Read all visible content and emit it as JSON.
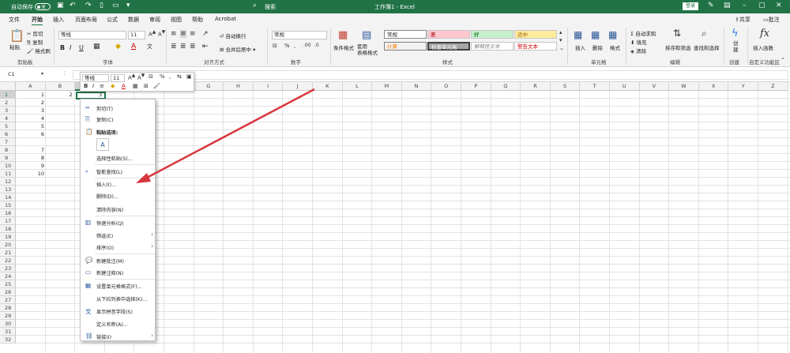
{
  "titlebar": {
    "autosave_label": "自动保存",
    "toggle_state": "关",
    "search_label": "搜索",
    "doc_title": "工作簿1 - Excel",
    "login_label": "登录"
  },
  "menu": [
    "文件",
    "开始",
    "插入",
    "页面布局",
    "公式",
    "数据",
    "审阅",
    "视图",
    "帮助",
    "Acrobat"
  ],
  "share_label": "共享",
  "comment_label": "批注",
  "ribbon": {
    "clipboard": {
      "paste": "粘贴",
      "cut": "剪切",
      "copy": "复制",
      "format_painter": "格式刷",
      "group": "剪贴板"
    },
    "font": {
      "name": "等线",
      "size": "11",
      "bold": "B",
      "italic": "I",
      "underline": "U",
      "group": "字体"
    },
    "alignment": {
      "wrap": "自动换行",
      "merge": "合并后居中",
      "group": "对齐方式"
    },
    "number": {
      "format": "常规",
      "group": "数字"
    },
    "styles": {
      "conditional": "条件格式",
      "table_format": "套用\n表格格式",
      "cells": [
        "常规",
        "差",
        "好",
        "适中",
        "计算",
        "检查单元格",
        "解释性文本",
        "警告文本"
      ],
      "group": "样式"
    },
    "cells": {
      "insert": "插入",
      "delete": "删除",
      "format": "格式",
      "group": "单元格"
    },
    "editing": {
      "autosum": "自动求和",
      "fill": "填充",
      "clear": "清除",
      "sort": "排序和筛选",
      "find": "查找和选择",
      "group": "编辑"
    },
    "create": {
      "label": "创\n建",
      "group": "创建"
    },
    "insert_fn": {
      "label": "插入函数",
      "group": "自定义功能区"
    }
  },
  "formula_bar": {
    "name_box": "C1"
  },
  "mini_toolbar": {
    "font": "等线",
    "size": "11"
  },
  "columns": [
    "A",
    "B",
    "C",
    "D",
    "E",
    "F",
    "G",
    "H",
    "I",
    "J",
    "K",
    "L",
    "M",
    "N",
    "O",
    "P",
    "Q",
    "R",
    "S",
    "T",
    "U",
    "V",
    "W",
    "X",
    "Y",
    "Z"
  ],
  "rows": [
    "1",
    "2",
    "3",
    "4",
    "5",
    "6",
    "7",
    "8",
    "9",
    "10",
    "11",
    "12",
    "13",
    "14",
    "15",
    "16",
    "17",
    "18",
    "19",
    "20",
    "21",
    "22",
    "23",
    "24",
    "25",
    "26",
    "27",
    "28",
    "29",
    "30",
    "31",
    "32"
  ],
  "colA_values": [
    "1",
    "2",
    "3",
    "4",
    "5",
    "6",
    "",
    "7",
    "8",
    "9",
    "10"
  ],
  "b1_value": "2",
  "c1_value": "3",
  "context_menu": [
    {
      "label": "剪切(T)",
      "icon": "scissors-icon"
    },
    {
      "label": "复制(C)",
      "icon": "copy-icon"
    },
    {
      "label": "粘贴选项:",
      "icon": "paste-icon",
      "bold": true
    },
    {
      "label": "选择性粘贴(S)...",
      "icon": ""
    },
    {
      "label": "智能查找(L)",
      "icon": "search-icon"
    },
    {
      "label": "插入(I)...",
      "icon": ""
    },
    {
      "label": "删除(D)...",
      "icon": ""
    },
    {
      "label": "清除内容(N)",
      "icon": ""
    },
    {
      "label": "快速分析(Q)",
      "icon": "quick-analysis-icon"
    },
    {
      "label": "筛选(E)",
      "icon": "",
      "submenu": true
    },
    {
      "label": "排序(O)",
      "icon": "",
      "submenu": true
    },
    {
      "label": "新建批注(M)",
      "icon": "new-comment-icon"
    },
    {
      "label": "新建注释(N)",
      "icon": "new-note-icon"
    },
    {
      "label": "设置单元格格式(F)...",
      "icon": "format-cells-icon"
    },
    {
      "label": "从下拉列表中选择(K)...",
      "icon": ""
    },
    {
      "label": "显示拼音字段(S)",
      "icon": "phonetic-icon"
    },
    {
      "label": "定义名称(A)...",
      "icon": ""
    },
    {
      "label": "链接(I)",
      "icon": "link-icon",
      "submenu": true
    }
  ],
  "colors": {
    "excel_green": "#217346",
    "arrow": "#d9363e"
  }
}
